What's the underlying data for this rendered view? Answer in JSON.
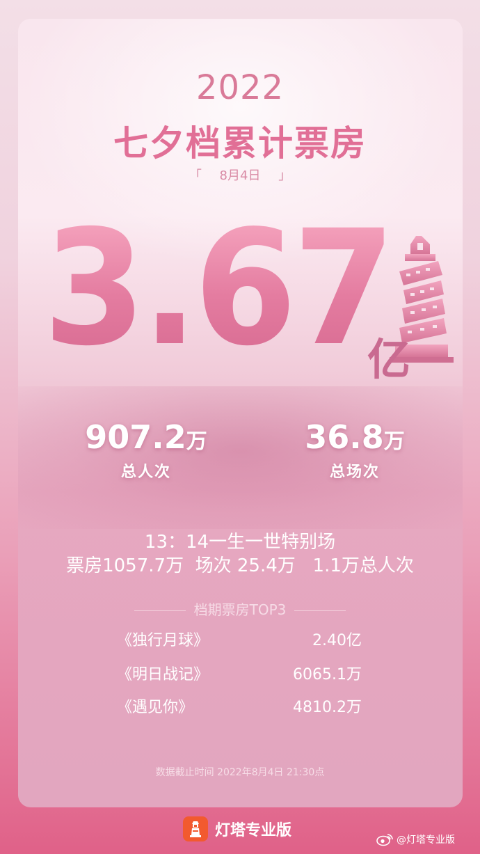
{
  "header": {
    "year": "2022",
    "title": "七夕档累计票房",
    "date": "8月4日",
    "bracket_left": "「",
    "bracket_right": "」"
  },
  "total": {
    "value": "3.67",
    "unit": "亿"
  },
  "stats": {
    "admissions_value": "907.2",
    "admissions_unit": "万",
    "admissions_label": "总人次",
    "shows_value": "36.8",
    "shows_unit": "万",
    "shows_label": "总场次"
  },
  "special": {
    "line1": "13：14一生一世特别场",
    "line2": "票房1057.7万  场次 25.4万   1.1万总人次"
  },
  "top3": {
    "heading": "档期票房TOP3",
    "items": [
      {
        "name": "《独行月球》",
        "gross": "2.40亿"
      },
      {
        "name": "《明日战记》",
        "gross": "6065.1万"
      },
      {
        "name": "《遇见你》",
        "gross": "4810.2万"
      }
    ]
  },
  "footnote": "数据截止时间 2022年8月4日 21:30点",
  "brand": {
    "name": "灯塔专业版",
    "icon": "lighthouse-icon"
  },
  "watermark": {
    "text": "@灯塔专业版",
    "icon": "weibo-icon"
  },
  "colors": {
    "accent": "#e16f96",
    "brand_orange": "#f25a2f",
    "background_bottom": "#e06188"
  }
}
